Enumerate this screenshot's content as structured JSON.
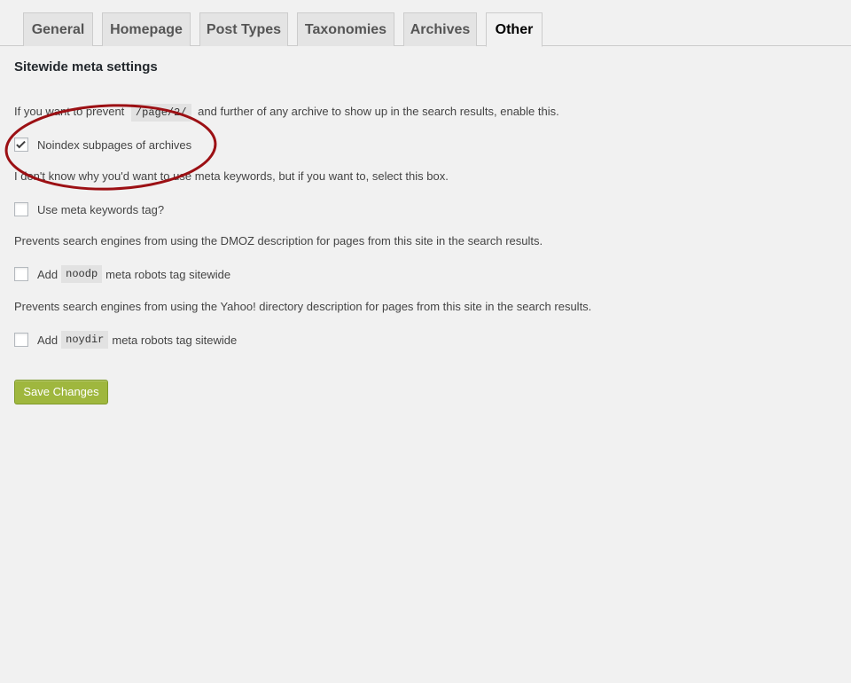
{
  "tabs": [
    {
      "label": "General",
      "active": false
    },
    {
      "label": "Homepage",
      "active": false
    },
    {
      "label": "Post Types",
      "active": false
    },
    {
      "label": "Taxonomies",
      "active": false
    },
    {
      "label": "Archives",
      "active": false
    },
    {
      "label": "Other",
      "active": true
    }
  ],
  "section_title": "Sitewide meta settings",
  "settings": [
    {
      "desc_before": "If you want to prevent",
      "desc_code": "/page/2/",
      "desc_after": "and further of any archive to show up in the search results, enable this.",
      "option_label": "Noindex subpages of archives",
      "checked": true
    },
    {
      "desc": "I don't know why you'd want to use meta keywords, but if you want to, select this box.",
      "option_label": "Use meta keywords tag?",
      "checked": false
    },
    {
      "desc": "Prevents search engines from using the DMOZ description for pages from this site in the search results.",
      "option_before": "Add",
      "option_code": "noodp",
      "option_after": "meta robots tag sitewide",
      "checked": false
    },
    {
      "desc": "Prevents search engines from using the Yahoo! directory description for pages from this site in the search results.",
      "option_before": "Add",
      "option_code": "noydir",
      "option_after": "meta robots tag sitewide",
      "checked": false
    }
  ],
  "save_button": "Save Changes",
  "colors": {
    "background": "#f1f1f1",
    "save_button": "#9fb73e",
    "annotation_circle": "#9c1014"
  }
}
